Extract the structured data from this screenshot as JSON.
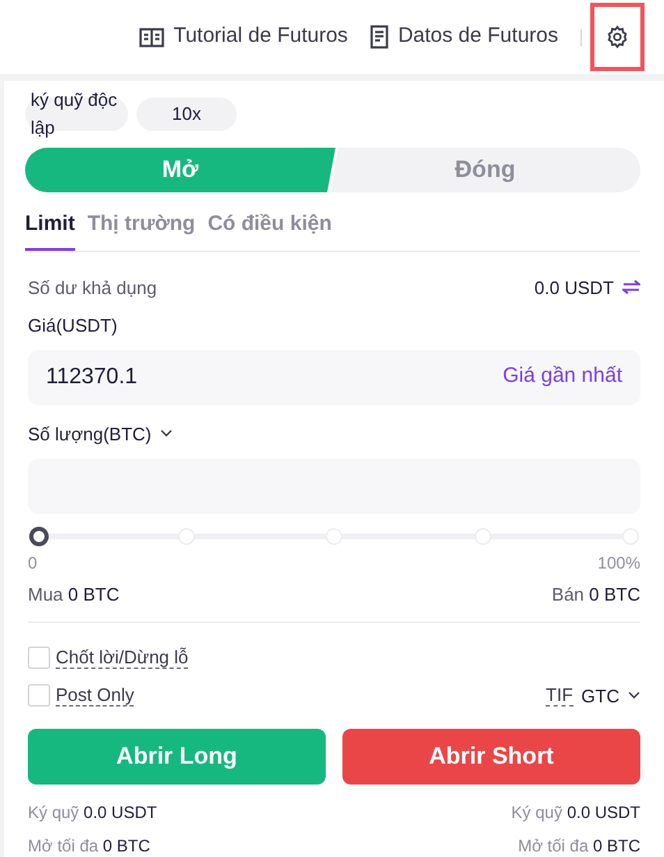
{
  "header": {
    "links": [
      {
        "label": "Tutorial de Futuros",
        "kind": "book"
      },
      {
        "label": "Datos de Futuros",
        "kind": "document"
      }
    ],
    "settings": {
      "highlighted": true
    }
  },
  "margin": {
    "mode": "ký quỹ độc lập",
    "leverage": "10x"
  },
  "sides": [
    {
      "label": "Mở",
      "selected": true
    },
    {
      "label": "Đóng",
      "selected": false
    }
  ],
  "order_types": [
    {
      "label": "Limit",
      "selected": true
    },
    {
      "label": "Thị trường",
      "selected": false
    },
    {
      "label": "Có điều kiện",
      "selected": false
    }
  ],
  "balance": {
    "label": "Số dư khả dụng",
    "value": "0.0 USDT"
  },
  "price": {
    "label": "Giá(USDT)",
    "value": "112370.1",
    "suffix": "Giá gần nhất"
  },
  "quantity": {
    "label": "Số lượng(BTC)"
  },
  "slider": {
    "level": 0,
    "min_label": "0",
    "max_label": "100%"
  },
  "amounts": [
    {
      "label": "Mua",
      "value": "0 BTC"
    },
    {
      "label": "Bán",
      "value": "0 BTC"
    }
  ],
  "options": [
    {
      "label": "Chốt lời/Dừng lỗ",
      "checked": false
    },
    {
      "label": "Post Only",
      "checked": false
    }
  ],
  "tif": {
    "label": "TIF",
    "value": "GTC"
  },
  "actions": [
    {
      "label": "Abrir Long",
      "kind": "long"
    },
    {
      "label": "Abrir Short",
      "kind": "short"
    }
  ],
  "summaries": [
    {
      "margin_label": "Ký quỹ",
      "margin": "0.0 USDT",
      "max_label": "Mở tối đa",
      "max": "0 BTC"
    },
    {
      "margin_label": "Ký quỹ",
      "margin": "0.0 USDT",
      "max_label": "Mở tối đa",
      "max": "0 BTC"
    }
  ]
}
